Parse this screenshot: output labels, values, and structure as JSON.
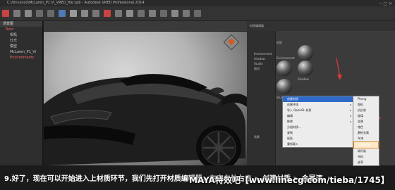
{
  "window": {
    "title": "C:\\Vincenzo\\McLaren_P1 Vi_VRED_file.vpb - Autodesk VRED Professional 2014",
    "controls": "─ □ ✕"
  },
  "scenegraph": {
    "title": "场景图",
    "items": [
      {
        "label": "Root",
        "selected": true
      },
      {
        "label": "相机",
        "selected": false
      },
      {
        "label": "灯光",
        "selected": false
      },
      {
        "label": "模型",
        "selected": false
      },
      {
        "label": "McLaren_P1_Vi",
        "selected": false
      },
      {
        "label": "Environments",
        "selected": true
      }
    ]
  },
  "material_editor": {
    "title": "材质编辑器",
    "sidebar_items": [
      "Environment",
      "Shadow",
      "Studio",
      "面材"
    ],
    "swatch_labels": [
      "材质",
      "Environment",
      "Shadow",
      "Studio"
    ],
    "bottom_label": "场景"
  },
  "context_menu": {
    "items": [
      {
        "label": "创建材质",
        "has_sub": true,
        "highlight": true
      },
      {
        "label": "创建环境",
        "has_sub": true,
        "highlight": false
      },
      {
        "label": "导入 OpenGL 材质",
        "has_sub": true,
        "highlight": false
      },
      {
        "label": "编辑",
        "has_sub": true,
        "highlight": false
      },
      {
        "label": "移除",
        "has_sub": true,
        "highlight": false
      },
      {
        "label": "分组材质...",
        "has_sub": false,
        "highlight": false
      },
      {
        "label": "复制",
        "has_sub": false,
        "highlight": false
      },
      {
        "label": "粘贴",
        "has_sub": false,
        "highlight": false
      },
      {
        "label": "重新载入",
        "has_sub": false,
        "highlight": false
      }
    ]
  },
  "submenu": {
    "items": [
      {
        "label": "Phong",
        "highlight": false
      },
      {
        "label": "塑料",
        "highlight": false
      },
      {
        "label": "抗反射",
        "highlight": false
      },
      {
        "label": "玻璃",
        "highlight": false
      },
      {
        "label": "金属",
        "highlight": false
      },
      {
        "label": "铬色",
        "highlight": false
      },
      {
        "label": "磨砂金属",
        "highlight": false
      },
      {
        "label": "车漆",
        "highlight": false
      },
      {
        "label": "金属车漆",
        "highlight": true
      },
      {
        "label": "碳纤维",
        "highlight": false
      },
      {
        "label": "布料",
        "highlight": false
      },
      {
        "label": "皮革",
        "highlight": false
      },
      {
        "label": "测量 2D",
        "highlight": false
      },
      {
        "label": "灯光",
        "highlight": false
      },
      {
        "label": "其他",
        "highlight": false
      }
    ]
  },
  "subtitle": {
    "text": "9.好了，现在可以开始进入上材质环节，我们先打开材质编辑器。在空白处右击 > 创建材质 > 金属漆。"
  },
  "watermark": {
    "maya": "MAYA",
    "rest": "特效吧【www.linecg.com/tieba/1745】"
  },
  "colors": {
    "accent_red": "#d63a3a",
    "menu_highlight": "#2e6bc9",
    "sub_highlight": "#e0902d"
  }
}
